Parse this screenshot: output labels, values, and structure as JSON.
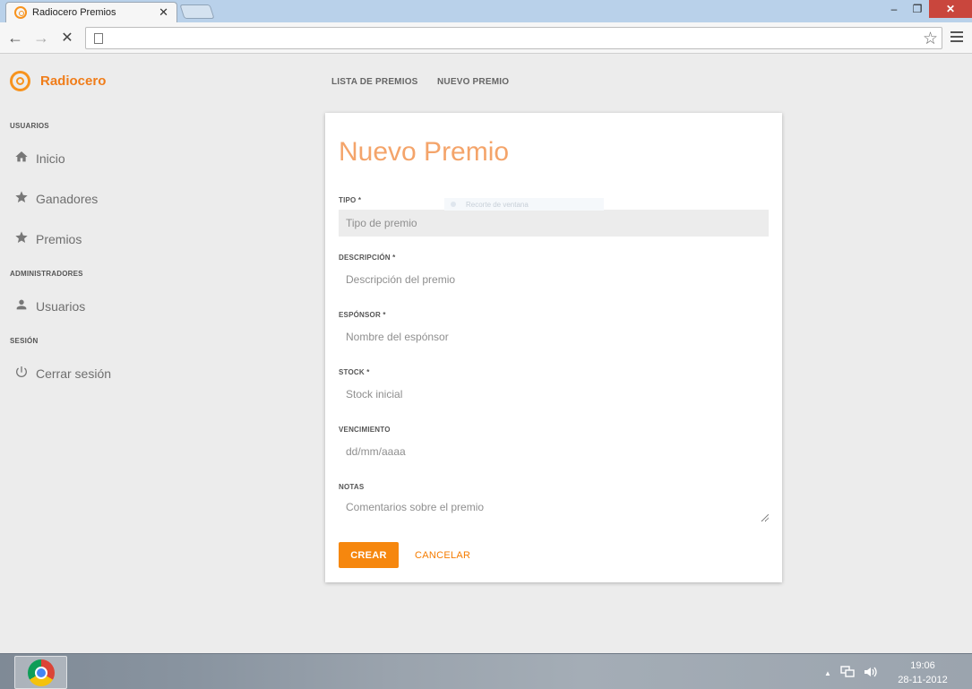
{
  "browser": {
    "tab_title": "Radiocero Premios",
    "tab_close": "✕",
    "win_min": "–",
    "win_restore": "❐",
    "win_close": "✕",
    "back": "←",
    "forward": "→",
    "stop": "✕",
    "bookmark_star": "☆"
  },
  "brand": {
    "name": "Radiocero",
    "accent": "#f7931e"
  },
  "sidebar": {
    "sections": [
      {
        "title": "USUARIOS",
        "items": [
          {
            "label": "Inicio",
            "icon": "home-icon"
          },
          {
            "label": "Ganadores",
            "icon": "star-icon"
          },
          {
            "label": "Premios",
            "icon": "star-icon"
          }
        ]
      },
      {
        "title": "ADMINISTRADORES",
        "items": [
          {
            "label": "Usuarios",
            "icon": "person-icon"
          }
        ]
      },
      {
        "title": "SESIÓN",
        "items": [
          {
            "label": "Cerrar sesión",
            "icon": "power-icon"
          }
        ]
      }
    ]
  },
  "topnav": {
    "items": [
      "LISTA DE PREMIOS",
      "NUEVO PREMIO"
    ]
  },
  "form": {
    "title": "Nuevo Premio",
    "fields": [
      {
        "label": "TIPO *",
        "placeholder": "Tipo de premio",
        "value": ""
      },
      {
        "label": "DESCRIPCIÓN *",
        "placeholder": "Descripción del premio",
        "value": ""
      },
      {
        "label": "ESPÓNSOR *",
        "placeholder": "Nombre del espónsor",
        "value": ""
      },
      {
        "label": "STOCK *",
        "placeholder": "Stock inicial",
        "value": ""
      },
      {
        "label": "VENCIMIENTO",
        "placeholder": "dd/mm/aaaa",
        "value": ""
      },
      {
        "label": "NOTAS",
        "placeholder": "Comentarios sobre el premio",
        "value": ""
      }
    ],
    "ghost_tooltip": "Recorte de ventana",
    "submit_label": "CREAR",
    "cancel_label": "CANCELAR"
  },
  "taskbar": {
    "tray_up": "▲",
    "time": "19:06",
    "date": "28-11-2012"
  }
}
